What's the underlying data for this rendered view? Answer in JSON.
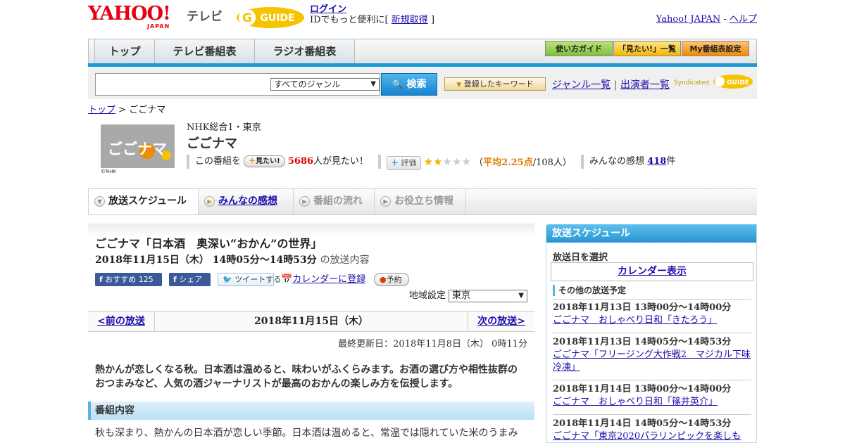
{
  "header": {
    "logo_text": "YAHOO!",
    "logo_sub": "JAPAN",
    "service": "テレビ",
    "gguide_logo": "GUIDE",
    "login_label": "ログイン",
    "login_prompt": "IDでもっと便利に[",
    "signup_label": "新規取得",
    "login_suffix": "]",
    "yahoo_japan_link": "Yahoo! JAPAN",
    "separator": "-",
    "help_link": "ヘルプ"
  },
  "nav": {
    "tabs": [
      "トップ",
      "テレビ番組表",
      "ラジオ番組表"
    ],
    "guide_buttons": [
      "使い方ガイド",
      "「見たい!」一覧",
      "My番組表設定"
    ]
  },
  "search": {
    "input_value": "",
    "genre_selected": "すべてのジャンル",
    "search_button": "検索",
    "keyword_button": "登録したキーワード",
    "genre_list_link": "ジャンル一覧",
    "divider": "|",
    "performer_list_link": "出演者一覧",
    "syndicated": "Syndicated"
  },
  "breadcrumb": {
    "top": "トップ",
    "sep": ">",
    "current": "ごごナマ"
  },
  "program": {
    "thumb_credit": "©NHK",
    "thumb_text": "ごごナマ",
    "channel": "NHK総合1・東京",
    "title": "ごごナマ",
    "want_prefix": "この番組を",
    "want_button": "見たい!",
    "want_count": "5686",
    "want_suffix": "人が見たい！",
    "eval_button": "評価",
    "rating_stars": 2,
    "rating_open": "（",
    "rating_avg_label": "平均2.25点",
    "rating_count": "/108人）",
    "impressions_label": "みんなの感想",
    "impressions_count": "418",
    "impressions_suffix": "件"
  },
  "content_tabs": [
    "放送スケジュール",
    "みんなの感想",
    "番組の流れ",
    "お役立ち情報"
  ],
  "episode": {
    "title": "ごごナマ「日本酒　奥深い“おかん”の世界」",
    "time": "2018年11月15日（木） 14時05分～14時53分",
    "time_suffix": "の放送内容",
    "fb_recommend": "おすすめ",
    "fb_count": "125",
    "fb_share": "シェア",
    "tweet": "ツイートする",
    "calendar": "カレンダーに登録",
    "reserve": "予約",
    "region_label": "地域設定",
    "region_value": "東京"
  },
  "pager": {
    "prev": "<前の放送",
    "current": "2018年11月15日（木）",
    "next": "次の放送>"
  },
  "updated": "最終更新日：2018年11月8日（木） 0時11分",
  "summary": "熱かんが恋しくなる秋。日本酒は温めると、味わいがふくらみます。お酒の選び方や相性抜群のおつまみなど、人気の酒ジャーナリストが最高のおかんの楽しみ方を伝授します。",
  "content_head": "番組内容",
  "content_body": "秋も深まり、熱かんの日本酒が恋しい季節。日本酒は温めると、常温では隠れていた米のうまみ",
  "sidebar": {
    "title": "放送スケジュール",
    "date_label": "放送日を選択",
    "calendar_link": "カレンダー表示",
    "other_label": "その他の放送予定",
    "items": [
      {
        "datetime": "2018年11月13日 13時00分～14時00分",
        "title": "ごごナマ　おしゃべり日和「きたろう」"
      },
      {
        "datetime": "2018年11月13日 14時05分～14時53分",
        "title": "ごごナマ「フリージング大作戦2　マジカル下味冷凍」"
      },
      {
        "datetime": "2018年11月14日 13時00分～14時00分",
        "title": "ごごナマ　おしゃべり日和「篠井英介」"
      },
      {
        "datetime": "2018年11月14日 14時05分～14時53分",
        "title": "ごごナマ「東京2020パラリンピックを楽しも"
      }
    ]
  },
  "colors": {
    "accent_blue": "#1998d6",
    "link": "#1a0dab",
    "yahoo_red": "#e60012",
    "rating_orange": "#e07a00"
  }
}
